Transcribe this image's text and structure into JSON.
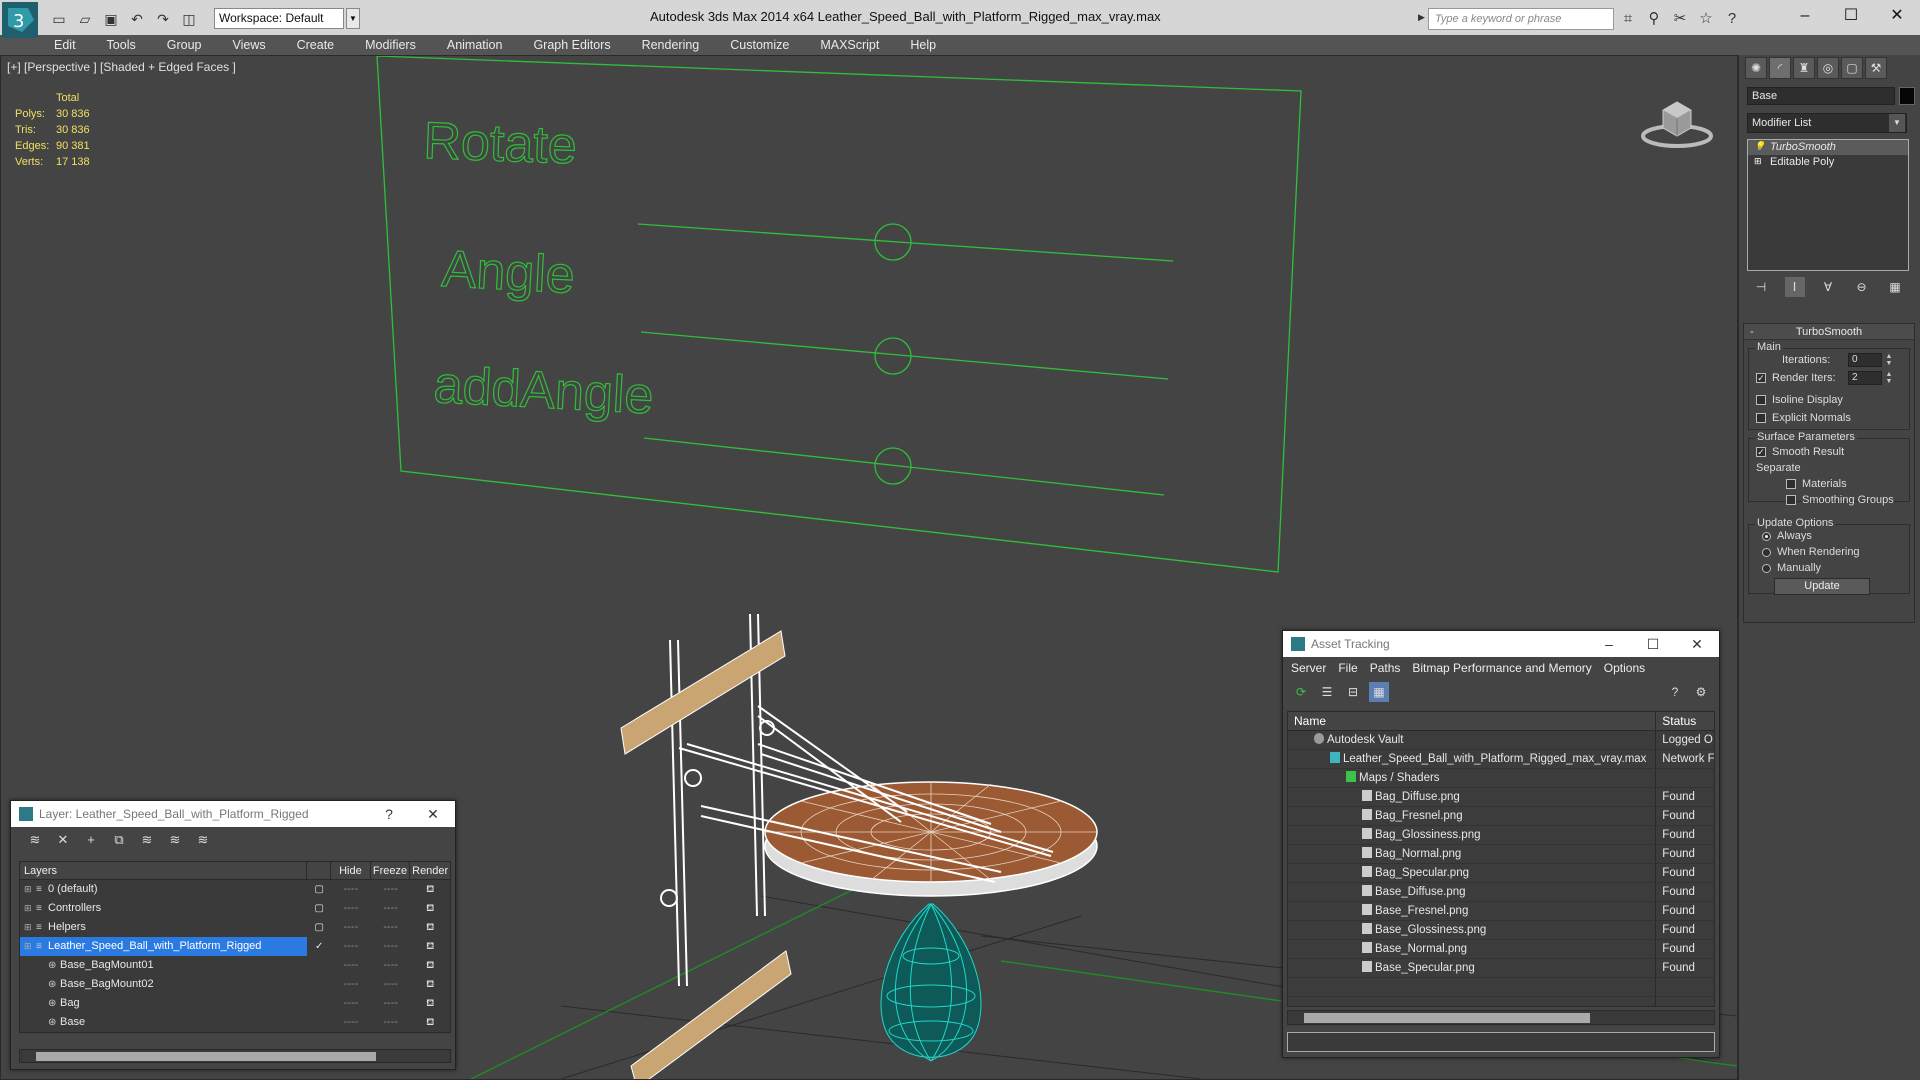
{
  "app": {
    "title": "Autodesk 3ds Max  2014 x64      Leather_Speed_Ball_with_Platform_Rigged_max_vray.max",
    "workspace": "Workspace: Default",
    "search_placeholder": "Type a keyword or phrase"
  },
  "menu": [
    "Edit",
    "Tools",
    "Group",
    "Views",
    "Create",
    "Modifiers",
    "Animation",
    "Graph Editors",
    "Rendering",
    "Customize",
    "MAXScript",
    "Help"
  ],
  "viewport": {
    "label": "[+] [Perspective ] [Shaded + Edged Faces ]",
    "stats_header": "Total",
    "stats": [
      {
        "key": "Polys:",
        "value": "30 836"
      },
      {
        "key": "Tris:",
        "value": "30 836"
      },
      {
        "key": "Edges:",
        "value": "90 381"
      },
      {
        "key": "Verts:",
        "value": "17 138"
      }
    ],
    "board_labels": [
      "Rotate",
      "Angle",
      "addAngle"
    ]
  },
  "command_panel": {
    "object_name": "Base",
    "modifier_list": "Modifier List",
    "stack": [
      {
        "label": "TurboSmooth",
        "selected": true
      },
      {
        "label": "Editable Poly",
        "selected": false
      }
    ],
    "rollout_title": "TurboSmooth",
    "main_group": "Main",
    "iterations_label": "Iterations:",
    "iterations_value": "0",
    "render_iters_label": "Render Iters:",
    "render_iters_value": "2",
    "isoline_display": "Isoline Display",
    "explicit_normals": "Explicit Normals",
    "surface_group": "Surface Parameters",
    "smooth_result": "Smooth Result",
    "separate": "Separate",
    "materials": "Materials",
    "smoothing_groups": "Smoothing Groups",
    "update_group": "Update Options",
    "always": "Always",
    "when_rendering": "When Rendering",
    "manually": "Manually",
    "update_button": "Update"
  },
  "layer_window": {
    "title": "Layer: Leather_Speed_Ball_with_Platform_Rigged",
    "help": "?",
    "columns": {
      "layers": "Layers",
      "hide": "Hide",
      "freeze": "Freeze",
      "render": "Render"
    },
    "rows": [
      {
        "name": "0 (default)",
        "indent": 1,
        "selected": false
      },
      {
        "name": "Controllers",
        "indent": 1,
        "selected": false
      },
      {
        "name": "Helpers",
        "indent": 1,
        "selected": false
      },
      {
        "name": "Leather_Speed_Ball_with_Platform_Rigged",
        "indent": 1,
        "selected": true
      },
      {
        "name": "Base_BagMount01",
        "indent": 2,
        "selected": false
      },
      {
        "name": "Base_BagMount02",
        "indent": 2,
        "selected": false
      },
      {
        "name": "Bag",
        "indent": 2,
        "selected": false
      },
      {
        "name": "Base",
        "indent": 2,
        "selected": false
      }
    ]
  },
  "asset_window": {
    "title": "Asset Tracking",
    "menu": [
      "Server",
      "File",
      "Paths",
      "Bitmap Performance and Memory",
      "Options"
    ],
    "columns": {
      "name": "Name",
      "status": "Status"
    },
    "rows": [
      {
        "name": "Autodesk Vault",
        "status": "Logged O",
        "indent": 1,
        "icon": "vault"
      },
      {
        "name": "Leather_Speed_Ball_with_Platform_Rigged_max_vray.max",
        "status": "Network F",
        "indent": 2,
        "icon": "max"
      },
      {
        "name": "Maps / Shaders",
        "status": "",
        "indent": 3,
        "icon": "folder"
      },
      {
        "name": "Bag_Diffuse.png",
        "status": "Found",
        "indent": 4,
        "icon": "file"
      },
      {
        "name": "Bag_Fresnel.png",
        "status": "Found",
        "indent": 4,
        "icon": "file"
      },
      {
        "name": "Bag_Glossiness.png",
        "status": "Found",
        "indent": 4,
        "icon": "file"
      },
      {
        "name": "Bag_Normal.png",
        "status": "Found",
        "indent": 4,
        "icon": "file"
      },
      {
        "name": "Bag_Specular.png",
        "status": "Found",
        "indent": 4,
        "icon": "file"
      },
      {
        "name": "Base_Diffuse.png",
        "status": "Found",
        "indent": 4,
        "icon": "file"
      },
      {
        "name": "Base_Fresnel.png",
        "status": "Found",
        "indent": 4,
        "icon": "file"
      },
      {
        "name": "Base_Glossiness.png",
        "status": "Found",
        "indent": 4,
        "icon": "file"
      },
      {
        "name": "Base_Normal.png",
        "status": "Found",
        "indent": 4,
        "icon": "file"
      },
      {
        "name": "Base_Specular.png",
        "status": "Found",
        "indent": 4,
        "icon": "file"
      }
    ]
  },
  "colors": {
    "wire_green": "#2fbf3a",
    "stats_yellow": "#f0e060",
    "selection_blue": "#2a7ae2",
    "bag_cyan": "#1fd8c8"
  }
}
